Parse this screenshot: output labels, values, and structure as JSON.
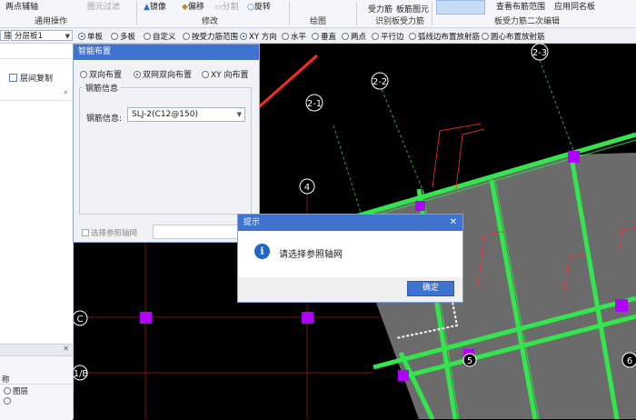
{
  "ribbon": {
    "top_items": [
      "两点辅轴",
      "图元过滤",
      "镜像",
      "偏移",
      "分割",
      "旋转",
      "受力筋",
      "板筋图元",
      "查看布筋范围",
      "应用同名板"
    ],
    "groups": [
      "通用操作",
      "修改",
      "绘图",
      "识别板受力筋",
      "板受力筋二次编辑"
    ]
  },
  "option_bar": {
    "floor_combo": "层",
    "layer_combo": "分层板1",
    "options": [
      "单板",
      "多板",
      "自定义",
      "按受力筋范围",
      "XY 方向",
      "水平",
      "垂直",
      "两点",
      "平行边",
      "弧线边布置放射筋",
      "圆心布置放射筋"
    ],
    "checked_single": "单板",
    "checked_dir": "XY 方向"
  },
  "left_panel": {
    "layer_copy": "层间复制",
    "col_header": "称",
    "row_label": "图层"
  },
  "smart_dialog": {
    "title": "智能布置",
    "radios": [
      "双向布置",
      "双网双向布置",
      "XY 向布置"
    ],
    "selected_radio": "双网双向布置",
    "group_label": "钢筋信息",
    "field_label": "钢筋信息:",
    "field_value": "SLJ-2(C12@150)",
    "checkbox_label": "选择参照轴网"
  },
  "prompt_dialog": {
    "title": "提示",
    "message": "请选择参照轴网",
    "ok_label": "确定",
    "close_glyph": "✕"
  },
  "canvas": {
    "axis_labels": [
      "2-3",
      "2-2",
      "2-1",
      "4",
      "C",
      "1/B",
      "5",
      "6"
    ]
  },
  "colors": {
    "slab_fill": "#6b6b6b",
    "beam": "#33e64d",
    "column": "#b000ff",
    "axis_line": "#ff3333",
    "arrow": "#ff2a1f",
    "dialog_title": "#3e74cf"
  },
  "icons": [
    "mirror-icon",
    "offset-icon",
    "split-icon",
    "rotate-icon",
    "search-icon",
    "info-icon",
    "close-icon",
    "dropdown-arrow-icon"
  ]
}
